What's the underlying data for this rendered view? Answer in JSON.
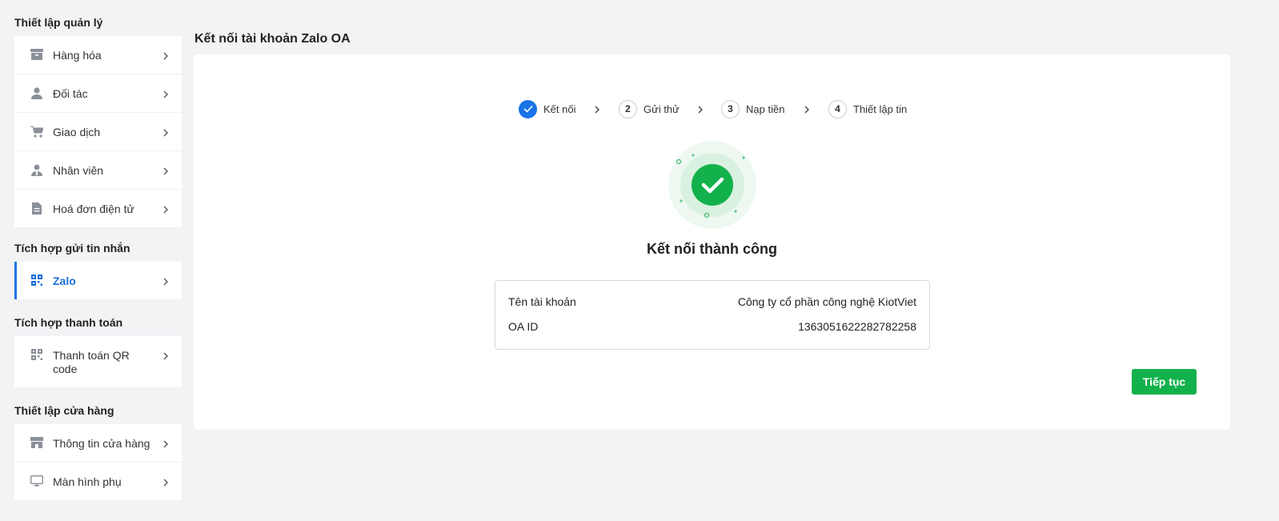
{
  "sidebar": {
    "sections": [
      {
        "title": "Thiết lập quản lý",
        "items": [
          {
            "label": "Hàng hóa",
            "icon": "box-icon"
          },
          {
            "label": "Đối tác",
            "icon": "user-icon"
          },
          {
            "label": "Giao dịch",
            "icon": "cart-icon"
          },
          {
            "label": "Nhân viên",
            "icon": "employee-icon"
          },
          {
            "label": "Hoá đơn điện tử",
            "icon": "document-icon"
          }
        ]
      },
      {
        "title": "Tích hợp gửi tin nhắn",
        "items": [
          {
            "label": "Zalo",
            "icon": "qr-icon",
            "active": true
          }
        ]
      },
      {
        "title": "Tích hợp thanh toán",
        "items": [
          {
            "label": "Thanh toán QR code",
            "icon": "qr-icon"
          }
        ]
      },
      {
        "title": "Thiết lập cửa hàng",
        "items": [
          {
            "label": "Thông tin cửa hàng",
            "icon": "store-icon"
          },
          {
            "label": "Màn hình phụ",
            "icon": "monitor-icon"
          }
        ]
      }
    ]
  },
  "main": {
    "title": "Kết nối tài khoản Zalo OA",
    "steps": [
      {
        "number": "",
        "label": "Kết nối",
        "status": "done"
      },
      {
        "number": "2",
        "label": "Gửi thử",
        "status": "pending"
      },
      {
        "number": "3",
        "label": "Nạp tiền",
        "status": "pending"
      },
      {
        "number": "4",
        "label": "Thiết lập tin",
        "status": "pending"
      }
    ],
    "success_title": "Kết nối thành công",
    "info": {
      "account_label": "Tên tài khoản",
      "account_value": "Công ty cổ phần công nghệ KiotViet",
      "oa_label": "OA ID",
      "oa_value": "1363051622282782258"
    },
    "continue_label": "Tiếp tục"
  },
  "colors": {
    "accent": "#1a73e8",
    "success": "#12b14b",
    "background": "#f2f3f5"
  }
}
